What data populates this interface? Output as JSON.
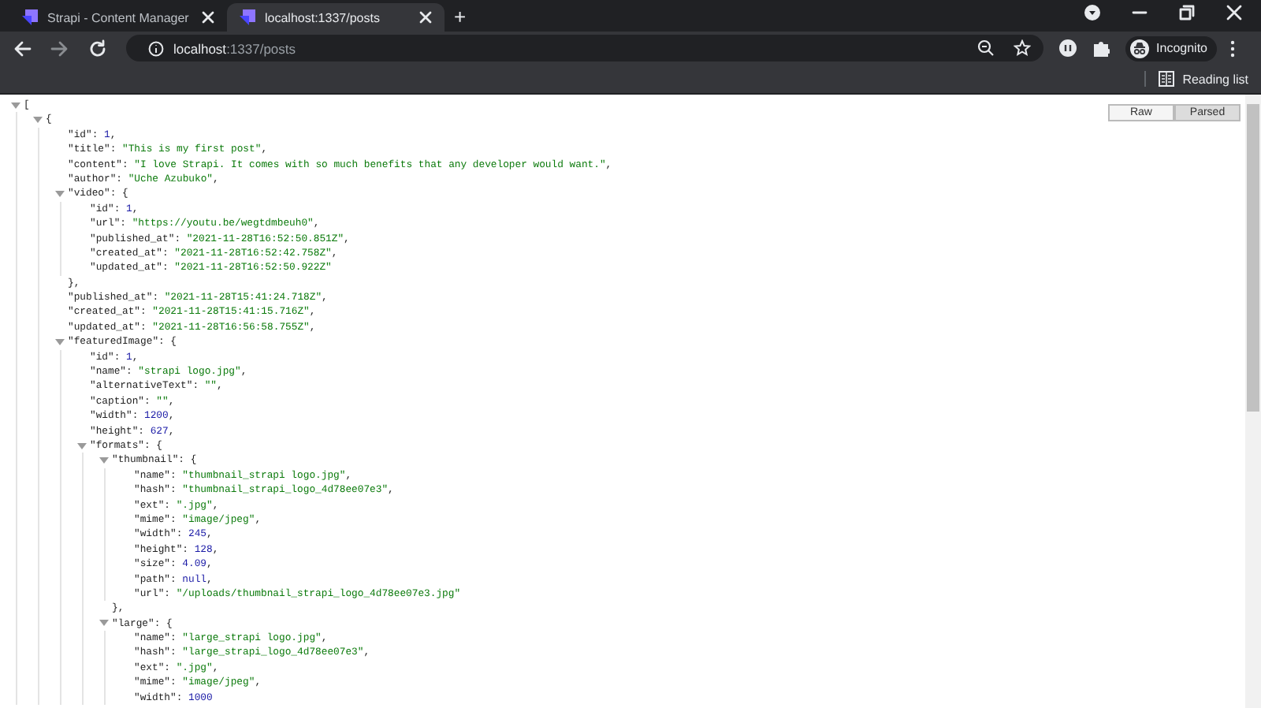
{
  "browser": {
    "tabs": [
      {
        "title": "Strapi - Content Manager",
        "selected": false
      },
      {
        "title": "localhost:1337/posts",
        "selected": true
      }
    ],
    "new_tab": "+",
    "address": {
      "host": "localhost",
      "path": ":1337/posts"
    },
    "profile": "Incognito",
    "reading_list": "Reading list"
  },
  "viewer": {
    "modes": [
      {
        "label": "Raw",
        "selected": false
      },
      {
        "label": "Parsed",
        "selected": true
      }
    ],
    "root": {
      "kind": "array",
      "open": "[",
      "expanded": true,
      "children": [
        {
          "kind": "object",
          "open": "{",
          "expanded": true,
          "children": [
            {
              "kind": "number",
              "key": "\"id\":",
              "value": "1",
              "end": ","
            },
            {
              "kind": "string",
              "key": "\"title\":",
              "value": "\"This is my first post\"",
              "end": ","
            },
            {
              "kind": "string",
              "key": "\"content\":",
              "value": "\"I love Strapi. It comes with so much benefits that any developer would want.\"",
              "end": ","
            },
            {
              "kind": "string",
              "key": "\"author\":",
              "value": "\"Uche Azubuko\"",
              "end": ","
            },
            {
              "kind": "object",
              "key": "\"video\":",
              "open": "{",
              "expanded": true,
              "close": "},",
              "children": [
                {
                  "kind": "number",
                  "key": "\"id\":",
                  "value": "1",
                  "end": ","
                },
                {
                  "kind": "string",
                  "key": "\"url\":",
                  "value": "\"https://youtu.be/wegtdmbeuh0\"",
                  "end": ","
                },
                {
                  "kind": "string",
                  "key": "\"published_at\":",
                  "value": "\"2021-11-28T16:52:50.851Z\"",
                  "end": ","
                },
                {
                  "kind": "string",
                  "key": "\"created_at\":",
                  "value": "\"2021-11-28T16:52:42.758Z\"",
                  "end": ","
                },
                {
                  "kind": "string",
                  "key": "\"updated_at\":",
                  "value": "\"2021-11-28T16:52:50.922Z\""
                }
              ]
            },
            {
              "kind": "string",
              "key": "\"published_at\":",
              "value": "\"2021-11-28T15:41:24.718Z\"",
              "end": ","
            },
            {
              "kind": "string",
              "key": "\"created_at\":",
              "value": "\"2021-11-28T15:41:15.716Z\"",
              "end": ","
            },
            {
              "kind": "string",
              "key": "\"updated_at\":",
              "value": "\"2021-11-28T16:56:58.755Z\"",
              "end": ","
            },
            {
              "kind": "object",
              "key": "\"featuredImage\":",
              "open": "{",
              "expanded": true,
              "children": [
                {
                  "kind": "number",
                  "key": "\"id\":",
                  "value": "1",
                  "end": ","
                },
                {
                  "kind": "string",
                  "key": "\"name\":",
                  "value": "\"strapi logo.jpg\"",
                  "end": ","
                },
                {
                  "kind": "string",
                  "key": "\"alternativeText\":",
                  "value": "\"\"",
                  "end": ","
                },
                {
                  "kind": "string",
                  "key": "\"caption\":",
                  "value": "\"\"",
                  "end": ","
                },
                {
                  "kind": "number",
                  "key": "\"width\":",
                  "value": "1200",
                  "end": ","
                },
                {
                  "kind": "number",
                  "key": "\"height\":",
                  "value": "627",
                  "end": ","
                },
                {
                  "kind": "object",
                  "key": "\"formats\":",
                  "open": "{",
                  "expanded": true,
                  "children": [
                    {
                      "kind": "object",
                      "key": "\"thumbnail\":",
                      "open": "{",
                      "expanded": true,
                      "close": "},",
                      "children": [
                        {
                          "kind": "string",
                          "key": "\"name\":",
                          "value": "\"thumbnail_strapi logo.jpg\"",
                          "end": ","
                        },
                        {
                          "kind": "string",
                          "key": "\"hash\":",
                          "value": "\"thumbnail_strapi_logo_4d78ee07e3\"",
                          "end": ","
                        },
                        {
                          "kind": "string",
                          "key": "\"ext\":",
                          "value": "\".jpg\"",
                          "end": ","
                        },
                        {
                          "kind": "string",
                          "key": "\"mime\":",
                          "value": "\"image/jpeg\"",
                          "end": ","
                        },
                        {
                          "kind": "number",
                          "key": "\"width\":",
                          "value": "245",
                          "end": ","
                        },
                        {
                          "kind": "number",
                          "key": "\"height\":",
                          "value": "128",
                          "end": ","
                        },
                        {
                          "kind": "number",
                          "key": "\"size\":",
                          "value": "4.09",
                          "end": ","
                        },
                        {
                          "kind": "null",
                          "key": "\"path\":",
                          "value": "null",
                          "end": ","
                        },
                        {
                          "kind": "string",
                          "key": "\"url\":",
                          "value": "\"/uploads/thumbnail_strapi_logo_4d78ee07e3.jpg\""
                        }
                      ]
                    },
                    {
                      "kind": "object",
                      "key": "\"large\":",
                      "open": "{",
                      "expanded": true,
                      "children": [
                        {
                          "kind": "string",
                          "key": "\"name\":",
                          "value": "\"large_strapi logo.jpg\"",
                          "end": ","
                        },
                        {
                          "kind": "string",
                          "key": "\"hash\":",
                          "value": "\"large_strapi_logo_4d78ee07e3\"",
                          "end": ","
                        },
                        {
                          "kind": "string",
                          "key": "\"ext\":",
                          "value": "\".jpg\"",
                          "end": ","
                        },
                        {
                          "kind": "string",
                          "key": "\"mime\":",
                          "value": "\"image/jpeg\"",
                          "end": ","
                        },
                        {
                          "kind": "number",
                          "key": "\"width\":",
                          "value": "1000"
                        }
                      ]
                    }
                  ]
                }
              ]
            }
          ]
        }
      ]
    }
  }
}
